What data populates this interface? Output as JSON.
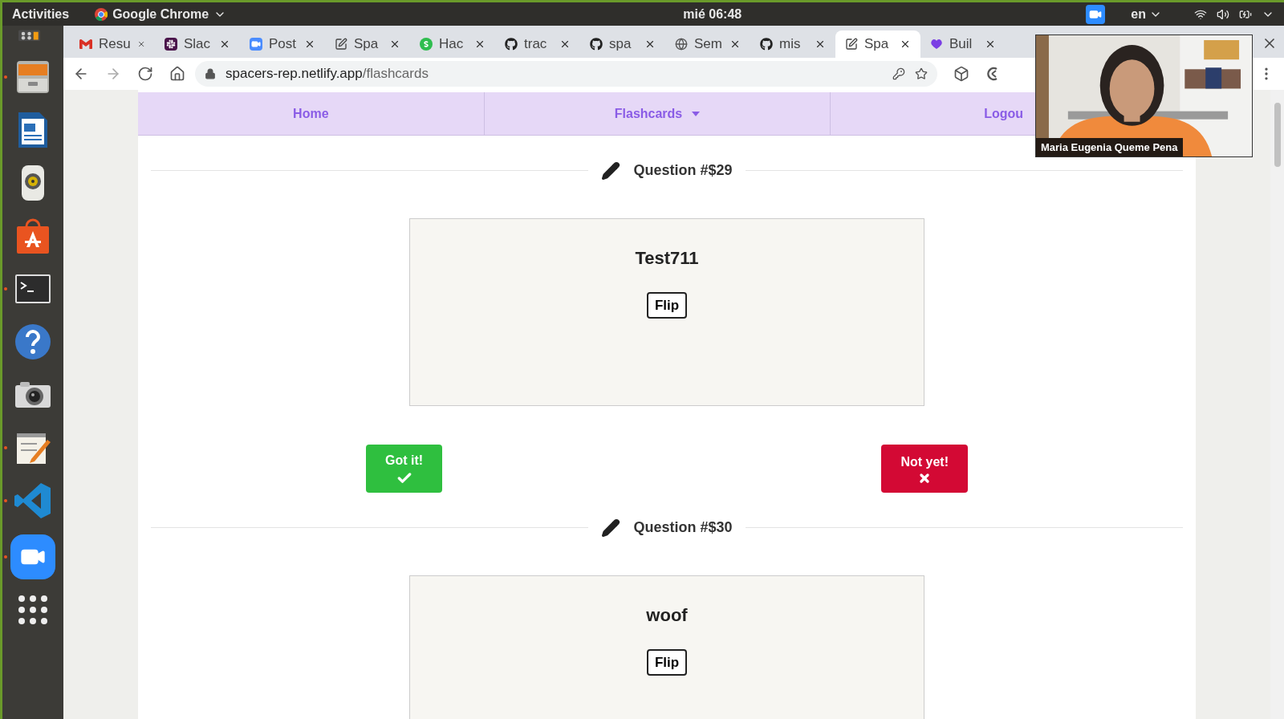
{
  "top_bar": {
    "activities": "Activities",
    "app_name": "Google Chrome",
    "clock": "mié 06:48",
    "language": "en"
  },
  "dock": [
    {
      "kind": "grid-partial",
      "running": false
    },
    {
      "kind": "files",
      "running": true
    },
    {
      "kind": "writer",
      "running": false
    },
    {
      "kind": "speaker",
      "running": false
    },
    {
      "kind": "store",
      "running": false
    },
    {
      "kind": "terminal",
      "running": true
    },
    {
      "kind": "help",
      "running": false
    },
    {
      "kind": "camera",
      "running": false
    },
    {
      "kind": "notes",
      "running": true
    },
    {
      "kind": "vscode",
      "running": true
    },
    {
      "kind": "zoom",
      "running": true
    },
    {
      "kind": "grid",
      "running": false
    }
  ],
  "tabs": [
    {
      "title": "Resu",
      "kind": "gmail",
      "selected": false
    },
    {
      "title": "Slac",
      "kind": "slack",
      "selected": false
    },
    {
      "title": "Post",
      "kind": "zoom",
      "selected": false
    },
    {
      "title": "Spa",
      "kind": "edit",
      "selected": false
    },
    {
      "title": "Hac",
      "kind": "s",
      "selected": false
    },
    {
      "title": "trac",
      "kind": "github",
      "selected": false
    },
    {
      "title": "spa",
      "kind": "github",
      "selected": false
    },
    {
      "title": "Sem",
      "kind": "globe",
      "selected": false
    },
    {
      "title": "mis",
      "kind": "github",
      "selected": false
    },
    {
      "title": "Spa",
      "kind": "edit",
      "selected": true
    },
    {
      "title": "Buil",
      "kind": "blob",
      "selected": false
    }
  ],
  "address_bar": {
    "host": "spacers-rep.netlify.app",
    "path": "/flashcards"
  },
  "nav": [
    {
      "label": "Home",
      "dropdown": false
    },
    {
      "label": "Flashcards",
      "dropdown": true
    },
    {
      "label": "Logou",
      "dropdown": false
    }
  ],
  "questions": [
    {
      "heading": "Question #$29",
      "card_text": "Test711",
      "flip": "Flip",
      "answers": [
        {
          "kind": "got",
          "label": "Got it!"
        },
        {
          "kind": "not",
          "label": "Not yet!"
        }
      ]
    },
    {
      "heading": "Question #$30",
      "card_text": "woof",
      "flip": "Flip"
    }
  ],
  "video_overlay": {
    "kind": "picture",
    "name": "Maria Eugenia Queme Pena"
  }
}
